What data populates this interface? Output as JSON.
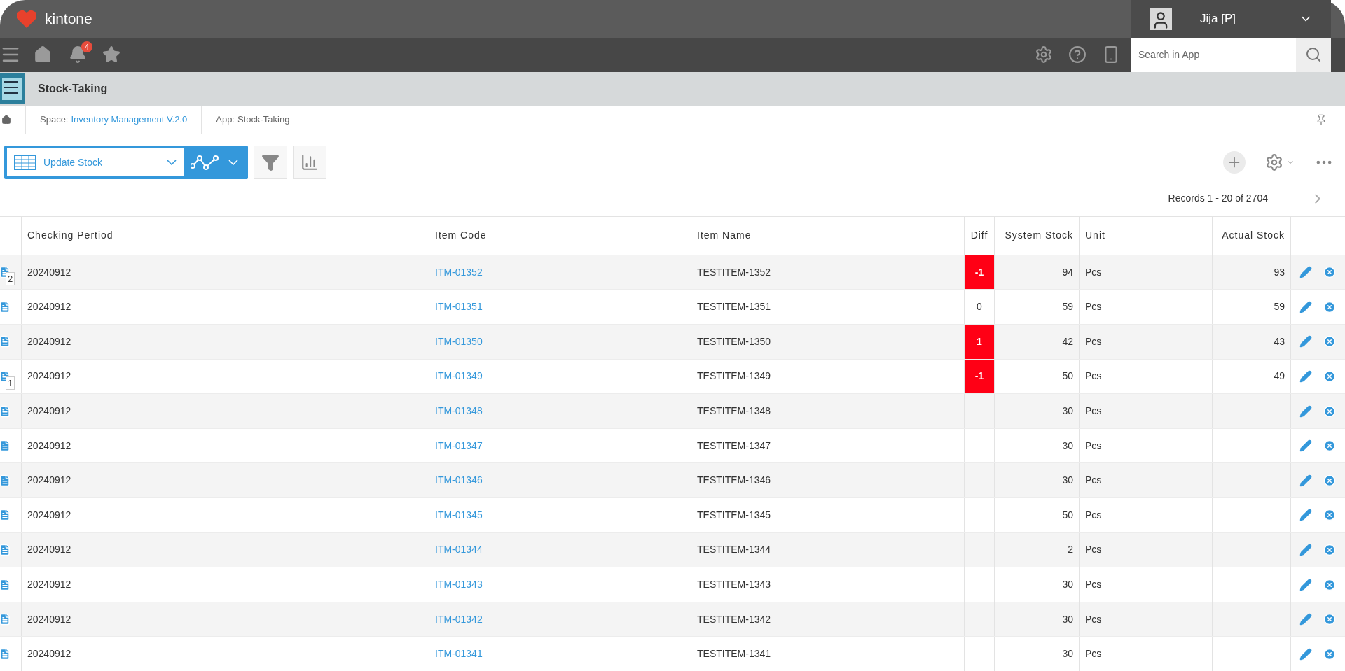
{
  "header": {
    "brand": "kintone",
    "user": "Jija [P]",
    "notifications": "4",
    "search": {
      "placeholder": "Search in App"
    }
  },
  "app": {
    "title": "Stock-Taking"
  },
  "breadcrumb": [
    {
      "prefix": "Space:",
      "label": "Inventory Management V.2.0",
      "link": true
    },
    {
      "prefix": "App:",
      "label": "Stock-Taking",
      "link": false
    }
  ],
  "view": {
    "name": "Update Stock"
  },
  "pagination": "Records 1 - 20 of 2704",
  "table": {
    "columns": [
      "Checking Pertiod",
      "Item Code",
      "Item Name",
      "Diff",
      "System Stock",
      "Unit",
      "Actual Stock"
    ],
    "rows": [
      {
        "comments": "2",
        "period": "20240912",
        "code": "ITM-01352",
        "name": "TESTITEM-1352",
        "diff": "-1",
        "alert": true,
        "system": "94",
        "unit": "Pcs",
        "actual": "93"
      },
      {
        "period": "20240912",
        "code": "ITM-01351",
        "name": "TESTITEM-1351",
        "diff": "0",
        "alert": false,
        "system": "59",
        "unit": "Pcs",
        "actual": "59"
      },
      {
        "period": "20240912",
        "code": "ITM-01350",
        "name": "TESTITEM-1350",
        "diff": "1",
        "alert": true,
        "system": "42",
        "unit": "Pcs",
        "actual": "43"
      },
      {
        "comments": "1",
        "period": "20240912",
        "code": "ITM-01349",
        "name": "TESTITEM-1349",
        "diff": "-1",
        "alert": true,
        "system": "50",
        "unit": "Pcs",
        "actual": "49"
      },
      {
        "period": "20240912",
        "code": "ITM-01348",
        "name": "TESTITEM-1348",
        "alert": false,
        "system": "30",
        "unit": "Pcs"
      },
      {
        "period": "20240912",
        "code": "ITM-01347",
        "name": "TESTITEM-1347",
        "alert": false,
        "system": "30",
        "unit": "Pcs"
      },
      {
        "period": "20240912",
        "code": "ITM-01346",
        "name": "TESTITEM-1346",
        "alert": false,
        "system": "30",
        "unit": "Pcs"
      },
      {
        "period": "20240912",
        "code": "ITM-01345",
        "name": "TESTITEM-1345",
        "alert": false,
        "system": "50",
        "unit": "Pcs"
      },
      {
        "period": "20240912",
        "code": "ITM-01344",
        "name": "TESTITEM-1344",
        "alert": false,
        "system": "2",
        "unit": "Pcs"
      },
      {
        "period": "20240912",
        "code": "ITM-01343",
        "name": "TESTITEM-1343",
        "alert": false,
        "system": "30",
        "unit": "Pcs"
      },
      {
        "period": "20240912",
        "code": "ITM-01342",
        "name": "TESTITEM-1342",
        "alert": false,
        "system": "30",
        "unit": "Pcs"
      },
      {
        "period": "20240912",
        "code": "ITM-01341",
        "name": "TESTITEM-1341",
        "alert": false,
        "system": "30",
        "unit": "Pcs"
      }
    ]
  }
}
